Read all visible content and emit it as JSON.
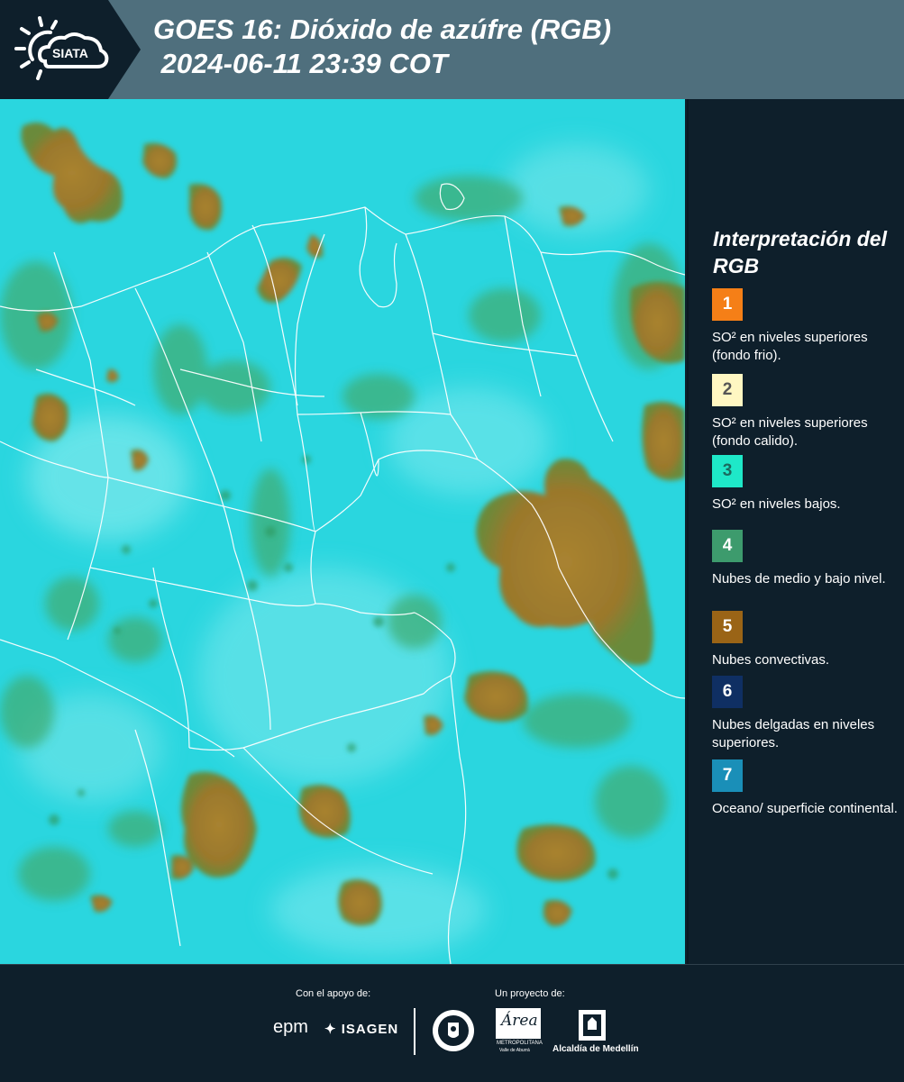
{
  "header": {
    "logo_text": "SIATA",
    "title_line1": "GOES 16: Dióxido de azúfre (RGB)",
    "title_line2": " 2024-06-11 23:39 COT"
  },
  "legend": {
    "title": "Interpretación del RGB",
    "items": [
      {
        "number": "1",
        "color": "#f57f17",
        "text": "SO² en niveles superiores (fondo frio)."
      },
      {
        "number": "2",
        "color": "#fff7c2",
        "text": "SO² en niveles superiores (fondo calido)."
      },
      {
        "number": "3",
        "color": "#1ee8c8",
        "text": "SO² en niveles bajos."
      },
      {
        "number": "4",
        "color": "#3d9b6d",
        "text": "Nubes de medio y bajo nivel."
      },
      {
        "number": "5",
        "color": "#9a6416",
        "text": "Nubes convectivas."
      },
      {
        "number": "6",
        "color": "#0f2f63",
        "text": "Nubes delgadas en niveles superiores."
      },
      {
        "number": "7",
        "color": "#1a8fb8",
        "text": "Oceano/ superficie continental."
      }
    ]
  },
  "footer": {
    "support_label": "Con el apoyo de:",
    "project_label": "Un proyecto de:",
    "sponsor_epm": "epm",
    "sponsor_isagen": "ISAGEN",
    "sponsor_area": "Área",
    "sponsor_area_sub": "METROPOLITANA",
    "sponsor_area_sub2": "Valle de Aburrá",
    "sponsor_alcaldia": "Alcaldía de Medellín"
  },
  "colors": {
    "background": "#0e1f2b",
    "header_band": "#4f6f7d",
    "map_base": "#2ad6df",
    "cloud_convective": "#a0782a",
    "cloud_low": "#3fae76"
  }
}
